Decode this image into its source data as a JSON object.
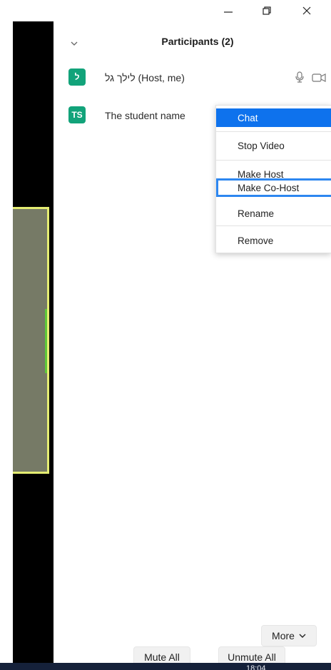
{
  "window_controls": {
    "minimize_icon": "minimize-icon",
    "maximize_icon": "restore-icon",
    "close_icon": "close-icon"
  },
  "participants_panel": {
    "title": "Participants (2)",
    "collapse_icon": "chevron-down-icon",
    "participants": [
      {
        "initials": "ל",
        "name": "לילך גל (Host, me)",
        "avatar_color": "#12a37a",
        "icons": [
          "microphone-icon",
          "video-camera-icon"
        ]
      },
      {
        "initials": "TS",
        "name": "The student name",
        "avatar_color": "#12a37a"
      }
    ]
  },
  "context_menu": {
    "items": [
      {
        "label": "Chat",
        "highlighted": true
      },
      {
        "label": "Stop Video"
      },
      {
        "label": "Make Host"
      },
      {
        "label": "Make Co-Host",
        "focused": true
      },
      {
        "label": "Rename"
      },
      {
        "label": "Remove"
      }
    ],
    "highlight_color": "#0e72ed"
  },
  "bottom_buttons": {
    "mute_all": "Mute All",
    "unmute_all": "Unmute All",
    "more": "More",
    "more_icon": "chevron-down-icon"
  },
  "taskbar": {
    "clock": "18:04"
  }
}
